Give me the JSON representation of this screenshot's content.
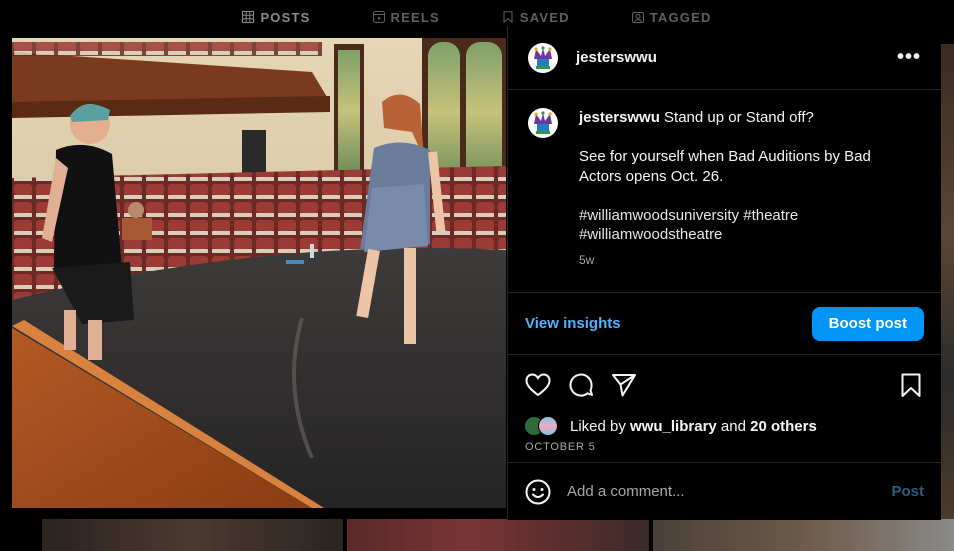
{
  "tabs": [
    {
      "label": "POSTS",
      "icon": "grid-icon",
      "active": true
    },
    {
      "label": "REELS",
      "icon": "reels-icon",
      "active": false
    },
    {
      "label": "SAVED",
      "icon": "bookmark-icon",
      "active": false
    },
    {
      "label": "TAGGED",
      "icon": "tagged-icon",
      "active": false
    }
  ],
  "post": {
    "username": "jesterswwu",
    "more_label": "•••",
    "caption": {
      "username": "jesterswwu",
      "line1": "Stand up or Stand off?",
      "line2a": "See for yourself when Bad Auditions by Bad",
      "line2b": "Actors opens Oct. 26.",
      "hashtags_a": "#williamwoodsuniversity #theatre",
      "hashtags_b": "#williamwoodstheatre",
      "age": "5w"
    },
    "insights_label": "View insights",
    "boost_label": "Boost post",
    "likes": {
      "prefix": "Liked by",
      "user": "wwu_library",
      "mid": "and",
      "others": "20 others"
    },
    "date": "OCTOBER 5",
    "comment_placeholder": "Add a comment...",
    "post_label": "Post"
  },
  "colors": {
    "accent": "#0095f6",
    "link": "#4fb3ff",
    "muted": "#a8a8a8",
    "border": "#262626"
  }
}
